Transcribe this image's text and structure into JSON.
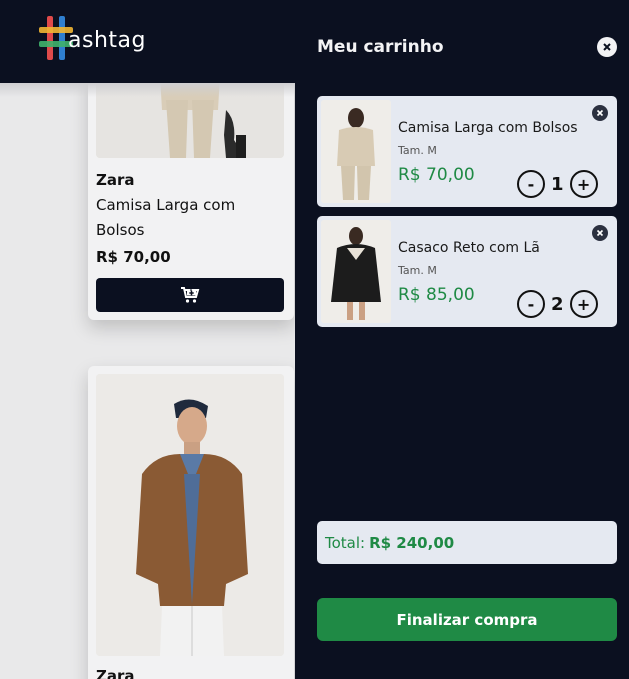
{
  "brand": {
    "logo_text": "ashtag",
    "colors": {
      "nav_bg": "#0b1020",
      "accent_green": "#1f8a45"
    }
  },
  "products": [
    {
      "brand": "Zara",
      "name": "Camisa Larga com Bolsos",
      "price": "R$ 70,00",
      "icon": "cart-plus-icon"
    },
    {
      "brand": "Zara"
    }
  ],
  "cart": {
    "title": "Meu carrinho",
    "close_icon": "close-icon",
    "items": [
      {
        "name": "Camisa Larga com Bolsos",
        "size": "Tam. M",
        "price": "R$ 70,00",
        "quantity": "1",
        "minus": "-",
        "plus": "+"
      },
      {
        "name": "Casaco Reto com Lã",
        "size": "Tam. M",
        "price": "R$ 85,00",
        "quantity": "2",
        "minus": "-",
        "plus": "+"
      }
    ],
    "total_label": "Total:",
    "total_value": "R$ 240,00",
    "checkout_label": "Finalizar compra"
  }
}
